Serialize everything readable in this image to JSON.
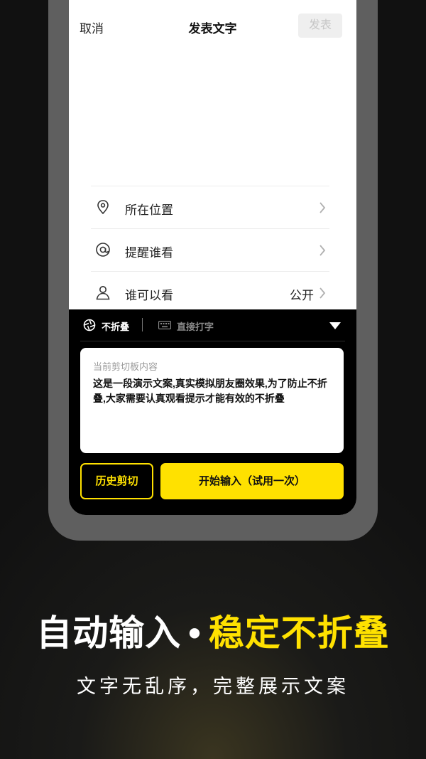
{
  "nav": {
    "cancel": "取消",
    "title": "发表文字",
    "publish": "发表"
  },
  "rows": [
    {
      "label": "所在位置",
      "value": "",
      "icon": "location-pin-icon"
    },
    {
      "label": "提醒谁看",
      "value": "",
      "icon": "at-sign-icon"
    },
    {
      "label": "谁可以看",
      "value": "公开",
      "icon": "person-icon"
    }
  ],
  "toolbar": {
    "fold_label": "不折叠",
    "typing_label": "直接打字"
  },
  "clipboard": {
    "title": "当前剪切板内容",
    "text": "这是一段演示文案,真实模拟朋友圈效果,为了防止不折叠,大家需要认真观看提示才能有效的不折叠"
  },
  "buttons": {
    "history": "历史剪切",
    "start": "开始输入（试用一次）"
  },
  "headline": {
    "part1": "自动输入",
    "dot": "•",
    "part2": "稳定不折叠"
  },
  "subline": "文字无乱序，完整展示文案",
  "colors": {
    "accent": "#ffe100",
    "panel": "#000000",
    "background": "#1b1b1b"
  }
}
